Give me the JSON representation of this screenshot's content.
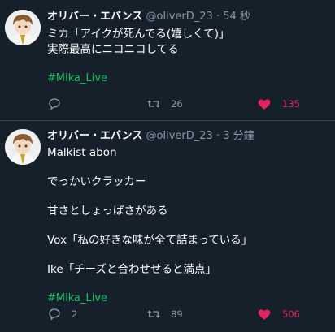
{
  "tweets": [
    {
      "author_name": "オリバー・エバンス",
      "author_handle": "@oliverD_23",
      "separator": "·",
      "time": "54 秒",
      "lines": [
        "ミカ「アイクが死んでる(嬉しくて)」",
        "実際最高にニコニコしてる"
      ],
      "hashtag": "#Mika_Live",
      "reply_count": "",
      "retweet_count": "26",
      "like_count": "135"
    },
    {
      "author_name": "オリバー・エバンス",
      "author_handle": "@oliverD_23",
      "separator": "·",
      "time": "3 分鐘",
      "lines": [
        "Malkist abon",
        "でっかいクラッカー",
        "甘さとしょっぱさがある",
        "Vox「私の好きな味が全て詰まっている」",
        "Ike「チーズと合わせせると満点」"
      ],
      "hashtag": "#Mika_Live",
      "reply_count": "2",
      "retweet_count": "89",
      "like_count": "506"
    }
  ],
  "colors": {
    "background": "#15202b",
    "divider": "#38444d",
    "muted": "#8899a6",
    "like": "#e0245e",
    "hashtag": "#17bf63"
  },
  "icons": {
    "reply": "reply-icon",
    "retweet": "retweet-icon",
    "like": "heart-icon"
  }
}
